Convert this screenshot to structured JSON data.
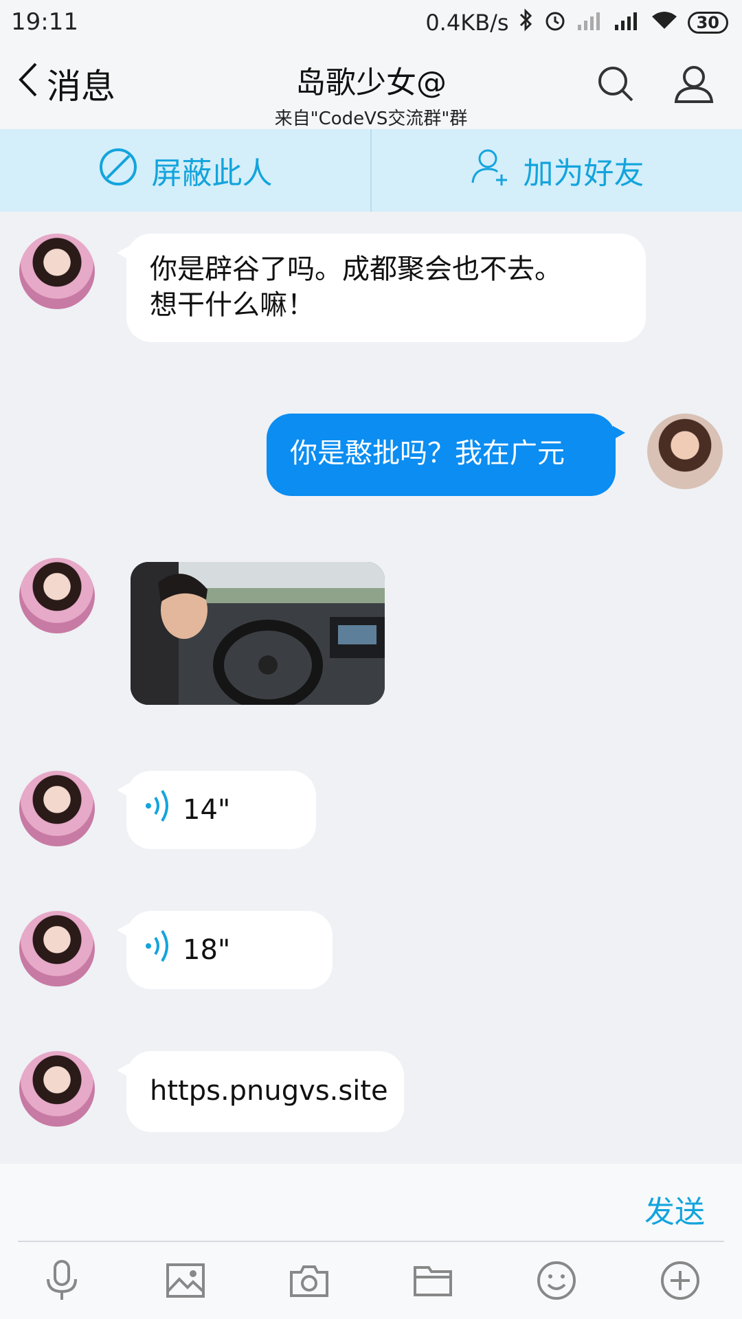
{
  "status_bar": {
    "time": "19:11",
    "speed": "0.4KB/s",
    "battery": "30"
  },
  "header": {
    "back_label": "消息",
    "title": "岛歌少女@",
    "subtitle": "来自\"CodeVS交流群\"群"
  },
  "actions": [
    {
      "label": "屏蔽此人",
      "icon": "block-icon"
    },
    {
      "label": "加为好友",
      "icon": "add-friend-icon"
    }
  ],
  "messages": [
    {
      "side": "left",
      "type": "text",
      "text": "你是辟谷了吗。成都聚会也不去。\n想干什么嘛！"
    },
    {
      "side": "right",
      "type": "text",
      "text": "你是憨批吗？我在广元"
    },
    {
      "side": "left",
      "type": "image",
      "alt": "driving-photo"
    },
    {
      "side": "left",
      "type": "voice",
      "duration": "14\""
    },
    {
      "side": "left",
      "type": "voice",
      "duration": "18\""
    },
    {
      "side": "left",
      "type": "text",
      "text": "https.pnugvs.site"
    }
  ],
  "composer": {
    "send_label": "发送",
    "tools": [
      "mic-icon",
      "image-icon",
      "camera-icon",
      "folder-icon",
      "emoji-icon",
      "plus-icon"
    ]
  },
  "colors": {
    "accent": "#13a4dc",
    "bubble_self": "#0b8df2",
    "background": "#eff1f5"
  }
}
